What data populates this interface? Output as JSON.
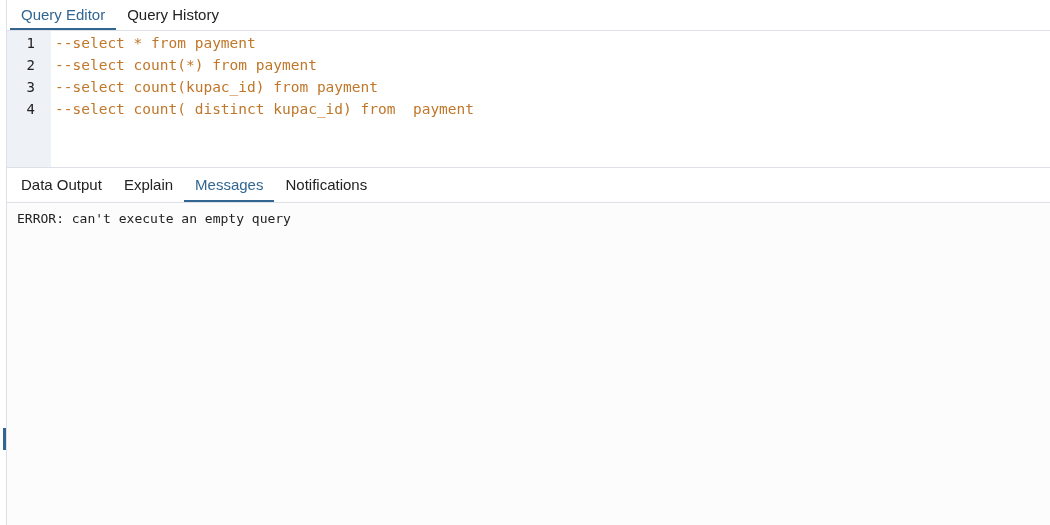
{
  "editor_tabs": [
    {
      "label": "Query Editor",
      "selected": true
    },
    {
      "label": "Query History",
      "selected": false
    }
  ],
  "editor": {
    "lines": [
      {
        "number": "1",
        "code": "--select * from payment"
      },
      {
        "number": "2",
        "code": "--select count(*) from payment"
      },
      {
        "number": "3",
        "code": "--select count(kupac_id) from payment"
      },
      {
        "number": "4",
        "code": "--select count( distinct kupac_id) from  payment"
      }
    ]
  },
  "output_tabs": [
    {
      "label": "Data Output",
      "selected": false
    },
    {
      "label": "Explain",
      "selected": false
    },
    {
      "label": "Messages",
      "selected": true
    },
    {
      "label": "Notifications",
      "selected": false
    }
  ],
  "messages": [
    "ERROR: can't execute an empty query"
  ]
}
